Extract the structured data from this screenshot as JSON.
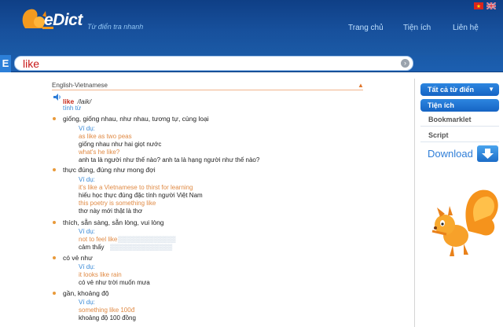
{
  "header": {
    "logo_text": "eDict",
    "slogan": "Từ điển tra nhanh",
    "nav": [
      "Trang chủ",
      "Tiện ích",
      "Liên hệ"
    ],
    "colors": {
      "header_blue": "#17509c",
      "accent_red": "#c82a1a",
      "link_blue": "#3b8ad6",
      "example_orange": "#e08a44"
    }
  },
  "search": {
    "badge": "E",
    "value": "like"
  },
  "dictionary": {
    "name": "English-Vietnamese",
    "headword": "like",
    "pronunciation": "/laik/",
    "part_of_speech": "tính từ",
    "senses": [
      {
        "meaning": "giống, giống nhau, như nhau, tương tự, cùng loại",
        "label": "Ví dụ:",
        "examples": [
          {
            "en": "as like as two peas",
            "vi": "giống nhau như hai giọt nước"
          },
          {
            "en": "what's he like?",
            "vi": "anh ta là người như thế nào? anh ta là hạng người như thế nào?"
          }
        ]
      },
      {
        "meaning": "thực đúng, đúng như mong đợi",
        "label": "Ví dụ:",
        "examples": [
          {
            "en": "it's like a Vietnamese to thirst for learning",
            "vi": "hiếu học thực đúng đặc tính người Việt Nam"
          },
          {
            "en": "this poetry is something like",
            "vi": "thơ này mới thật là thơ"
          }
        ]
      },
      {
        "meaning": "thích, sẵn sàng, sẵn lòng, vui lòng",
        "label": "Ví dụ:",
        "examples": [
          {
            "en": "not to feel like",
            "vi": "cảm thấy"
          }
        ]
      },
      {
        "meaning": "có vẻ như",
        "label": "Ví dụ:",
        "examples": [
          {
            "en": "it looks like rain",
            "vi": "có vẻ như trời muốn mưa"
          }
        ]
      },
      {
        "meaning": "gần, khoảng độ",
        "label": "Ví dụ:",
        "examples": [
          {
            "en": "something like 100đ",
            "vi": "khoảng độ 100 đồng"
          }
        ]
      }
    ]
  },
  "sidebar": {
    "all_dicts": "Tất cả từ điển",
    "utilities": "Tiện ích",
    "bookmarklet": "Bookmarklet",
    "script": "Script",
    "download": "Download"
  }
}
